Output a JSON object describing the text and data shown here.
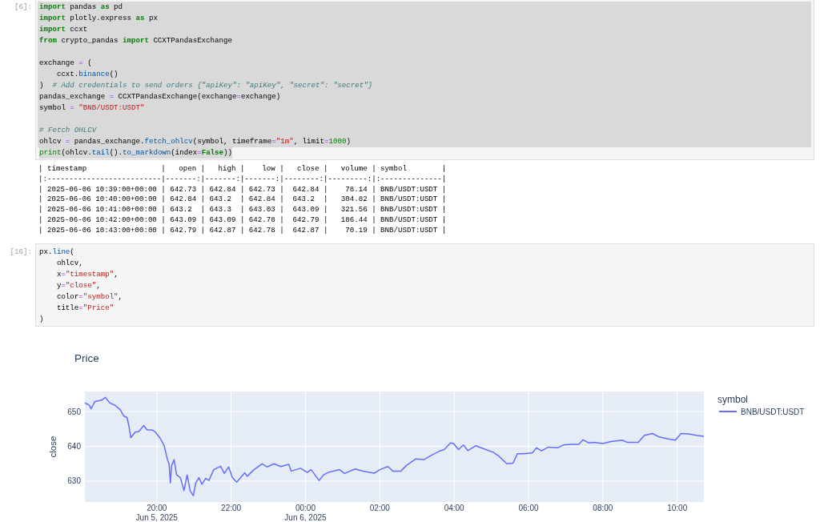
{
  "cells": [
    {
      "kind": "code",
      "prompt": "[6]:",
      "selected": true,
      "lines": [
        {
          "kind": "code",
          "tokens": [
            {
              "kind": "keyword",
              "text": "import"
            },
            {
              "kind": "plain",
              "text": " pandas "
            },
            {
              "kind": "keyword",
              "text": "as"
            },
            {
              "kind": "plain",
              "text": " pd"
            }
          ]
        },
        {
          "kind": "code",
          "tokens": [
            {
              "kind": "keyword",
              "text": "import"
            },
            {
              "kind": "plain",
              "text": " plotly.express "
            },
            {
              "kind": "keyword",
              "text": "as"
            },
            {
              "kind": "plain",
              "text": " px"
            }
          ]
        },
        {
          "kind": "code",
          "tokens": [
            {
              "kind": "keyword",
              "text": "import"
            },
            {
              "kind": "plain",
              "text": " ccxt"
            }
          ]
        },
        {
          "kind": "code",
          "tokens": [
            {
              "kind": "keyword",
              "text": "from"
            },
            {
              "kind": "plain",
              "text": " crypto_pandas "
            },
            {
              "kind": "keyword",
              "text": "import"
            },
            {
              "kind": "plain",
              "text": " CCXTPandasExchange"
            }
          ]
        },
        {
          "kind": "blank"
        },
        {
          "kind": "code",
          "tokens": [
            {
              "kind": "plain",
              "text": "exchange "
            },
            {
              "kind": "operator",
              "text": "="
            },
            {
              "kind": "plain",
              "text": " ("
            }
          ]
        },
        {
          "kind": "code",
          "tokens": [
            {
              "kind": "plain",
              "text": "    ccxt."
            },
            {
              "kind": "property",
              "text": "binance"
            },
            {
              "kind": "plain",
              "text": "()"
            }
          ]
        },
        {
          "kind": "code",
          "tokens": [
            {
              "kind": "plain",
              "text": ")  "
            },
            {
              "kind": "comment",
              "text": "# Add credentials to send orders {\"apiKey\": \"apiKey\", \"secret\": \"secret\"}"
            }
          ]
        },
        {
          "kind": "code",
          "tokens": [
            {
              "kind": "plain",
              "text": "pandas_exchange "
            },
            {
              "kind": "operator",
              "text": "="
            },
            {
              "kind": "plain",
              "text": " CCXTPandasExchange(exchange"
            },
            {
              "kind": "operator",
              "text": "="
            },
            {
              "kind": "plain",
              "text": "exchange)"
            }
          ]
        },
        {
          "kind": "code",
          "tokens": [
            {
              "kind": "plain",
              "text": "symbol "
            },
            {
              "kind": "operator",
              "text": "="
            },
            {
              "kind": "string",
              "text": " \"BNB/USDT:USDT\""
            }
          ]
        },
        {
          "kind": "blank"
        },
        {
          "kind": "code",
          "tokens": [
            {
              "kind": "comment",
              "text": "# Fetch OHLCV"
            }
          ]
        },
        {
          "kind": "code",
          "tokens": [
            {
              "kind": "plain",
              "text": "ohlcv "
            },
            {
              "kind": "operator",
              "text": "="
            },
            {
              "kind": "plain",
              "text": " pandas_exchange."
            },
            {
              "kind": "property",
              "text": "fetch_ohlcv"
            },
            {
              "kind": "plain",
              "text": "(symbol, timeframe"
            },
            {
              "kind": "operator",
              "text": "="
            },
            {
              "kind": "string",
              "text": "\"1m\""
            },
            {
              "kind": "plain",
              "text": ", limit"
            },
            {
              "kind": "operator",
              "text": "="
            },
            {
              "kind": "number",
              "text": "1000"
            },
            {
              "kind": "plain",
              "text": ")"
            }
          ]
        },
        {
          "kind": "code",
          "tokens": [
            {
              "kind": "builtin",
              "text": "print"
            },
            {
              "kind": "plain",
              "text": "(ohlcv."
            },
            {
              "kind": "property",
              "text": "tail"
            },
            {
              "kind": "plain",
              "text": "()."
            },
            {
              "kind": "property",
              "text": "to_markdown"
            },
            {
              "kind": "plain",
              "text": "(index"
            },
            {
              "kind": "operator",
              "text": "="
            },
            {
              "kind": "keyword",
              "text": "False"
            },
            {
              "kind": "plain",
              "text": "))"
            }
          ]
        }
      ]
    },
    {
      "kind": "output",
      "lines": [
        "| timestamp                 |   open |   high |    low |   close |   volume | symbol        |",
        "|:--------------------------|-------:|-------:|-------:|--------:|---------:|:--------------|",
        "| 2025-06-06 10:39:00+00:00 | 642.73 | 642.84 | 642.73 |  642.84 |    78.14 | BNB/USDT:USDT |",
        "| 2025-06-06 10:40:00+00:00 | 642.84 | 643.2  | 642.84 |  643.2  |   304.82 | BNB/USDT:USDT |",
        "| 2025-06-06 10:41:00+00:00 | 643.2  | 643.3  | 643.03 |  643.09 |   321.56 | BNB/USDT:USDT |",
        "| 2025-06-06 10:42:00+00:00 | 643.09 | 643.09 | 642.78 |  642.79 |   186.44 | BNB/USDT:USDT |",
        "| 2025-06-06 10:43:00+00:00 | 642.79 | 642.87 | 642.78 |  642.87 |    70.19 | BNB/USDT:USDT |"
      ]
    },
    {
      "kind": "code",
      "prompt": "[16]:",
      "selected": false,
      "lines": [
        {
          "kind": "code",
          "tokens": [
            {
              "kind": "plain",
              "text": "px."
            },
            {
              "kind": "property",
              "text": "line"
            },
            {
              "kind": "plain",
              "text": "("
            }
          ]
        },
        {
          "kind": "code",
          "tokens": [
            {
              "kind": "plain",
              "text": "    ohlcv,"
            }
          ]
        },
        {
          "kind": "code",
          "tokens": [
            {
              "kind": "plain",
              "text": "    x"
            },
            {
              "kind": "operator",
              "text": "="
            },
            {
              "kind": "string",
              "text": "\"timestamp\""
            },
            {
              "kind": "plain",
              "text": ","
            }
          ]
        },
        {
          "kind": "code",
          "tokens": [
            {
              "kind": "plain",
              "text": "    y"
            },
            {
              "kind": "operator",
              "text": "="
            },
            {
              "kind": "string",
              "text": "\"close\""
            },
            {
              "kind": "plain",
              "text": ","
            }
          ]
        },
        {
          "kind": "code",
          "tokens": [
            {
              "kind": "plain",
              "text": "    color"
            },
            {
              "kind": "operator",
              "text": "="
            },
            {
              "kind": "string",
              "text": "\"symbol\""
            },
            {
              "kind": "plain",
              "text": ","
            }
          ]
        },
        {
          "kind": "code",
          "tokens": [
            {
              "kind": "plain",
              "text": "    title"
            },
            {
              "kind": "operator",
              "text": "="
            },
            {
              "kind": "string",
              "text": "\"Price\""
            }
          ]
        },
        {
          "kind": "code",
          "tokens": [
            {
              "kind": "plain",
              "text": ")"
            }
          ]
        }
      ]
    },
    {
      "kind": "figure",
      "legend_title": "symbol",
      "chart_data": {
        "type": "line",
        "title": "Price",
        "ylabel": "close",
        "grid": true,
        "x": [
          "2025-06-05 18:04",
          "2025-06-05 18:11",
          "2025-06-05 18:14",
          "2025-06-05 18:20",
          "2025-06-05 18:31",
          "2025-06-05 18:37",
          "2025-06-05 18:44",
          "2025-06-05 18:52",
          "2025-06-05 19:01",
          "2025-06-05 19:07",
          "2025-06-05 19:12",
          "2025-06-05 19:15",
          "2025-06-05 19:18",
          "2025-06-05 19:25",
          "2025-06-05 19:31",
          "2025-06-05 19:39",
          "2025-06-05 19:44",
          "2025-06-05 19:53",
          "2025-06-05 19:58",
          "2025-06-05 20:06",
          "2025-06-05 20:12",
          "2025-06-05 20:17",
          "2025-06-05 20:20",
          "2025-06-05 20:22",
          "2025-06-05 20:24",
          "2025-06-05 20:28",
          "2025-06-05 20:32",
          "2025-06-05 20:38",
          "2025-06-05 20:44",
          "2025-06-05 20:49",
          "2025-06-05 20:54",
          "2025-06-05 20:59",
          "2025-06-05 21:03",
          "2025-06-05 21:08",
          "2025-06-05 21:13",
          "2025-06-05 21:19",
          "2025-06-05 21:24",
          "2025-06-05 21:32",
          "2025-06-05 21:43",
          "2025-06-05 21:49",
          "2025-06-05 21:56",
          "2025-06-05 22:02",
          "2025-06-05 22:09",
          "2025-06-05 22:22",
          "2025-06-05 22:26",
          "2025-06-05 22:37",
          "2025-06-05 22:50",
          "2025-06-05 22:58",
          "2025-06-05 23:09",
          "2025-06-05 23:20",
          "2025-06-05 23:33",
          "2025-06-05 23:37",
          "2025-06-05 23:52",
          "2025-06-06 00:03",
          "2025-06-06 00:09",
          "2025-06-06 00:22",
          "2025-06-06 00:29",
          "2025-06-06 00:37",
          "2025-06-06 00:55",
          "2025-06-06 01:03",
          "2025-06-06 01:20",
          "2025-06-06 01:33",
          "2025-06-06 01:51",
          "2025-06-06 02:00",
          "2025-06-06 02:13",
          "2025-06-06 02:21",
          "2025-06-06 02:34",
          "2025-06-06 02:43",
          "2025-06-06 02:58",
          "2025-06-06 03:11",
          "2025-06-06 03:24",
          "2025-06-06 03:37",
          "2025-06-06 03:44",
          "2025-06-06 03:54",
          "2025-06-06 03:59",
          "2025-06-06 04:07",
          "2025-06-06 04:15",
          "2025-06-06 04:22",
          "2025-06-06 04:35",
          "2025-06-06 04:51",
          "2025-06-06 05:03",
          "2025-06-06 05:12",
          "2025-06-06 05:19",
          "2025-06-06 05:25",
          "2025-06-06 05:35",
          "2025-06-06 05:42",
          "2025-06-06 05:51",
          "2025-06-06 06:06",
          "2025-06-06 06:13",
          "2025-06-06 06:21",
          "2025-06-06 06:32",
          "2025-06-06 06:47",
          "2025-06-06 06:56",
          "2025-06-06 07:09",
          "2025-06-06 07:21",
          "2025-06-06 07:28",
          "2025-06-06 07:37",
          "2025-06-06 07:45",
          "2025-06-06 08:00",
          "2025-06-06 08:13",
          "2025-06-06 08:31",
          "2025-06-06 08:39",
          "2025-06-06 08:57",
          "2025-06-06 09:07",
          "2025-06-06 09:20",
          "2025-06-06 09:31",
          "2025-06-06 09:44",
          "2025-06-06 09:57",
          "2025-06-06 10:06",
          "2025-06-06 10:18",
          "2025-06-06 10:31",
          "2025-06-06 10:43"
        ],
        "series": [
          {
            "name": "BNB/USDT:USDT",
            "color": "#636efa",
            "values": [
              652.5,
              651.9,
              650.8,
              652.9,
              653.3,
              654.1,
              652.5,
              651.9,
              650.6,
              648.7,
              648.3,
              646,
              642.5,
              644.1,
              644.3,
              646,
              644.8,
              644.7,
              644.1,
              642.2,
              640.2,
              636.4,
              634.8,
              629.5,
              634.5,
              636.2,
              631.8,
              631,
              627.3,
              631.8,
              627.2,
              625.8,
              629.5,
              631,
              629.1,
              630.8,
              630.2,
              633.3,
              634.3,
              632.2,
              634.1,
              631,
              629.7,
              632.4,
              631.4,
              633.3,
              635,
              634.1,
              635,
              634.2,
              634.8,
              632.9,
              633.7,
              632.5,
              633.3,
              630.2,
              631.8,
              632.5,
              633.3,
              632.2,
              633.5,
              632.9,
              632.3,
              633.3,
              634.2,
              632.9,
              632.9,
              634.5,
              636.4,
              636.2,
              637.5,
              638.7,
              639.1,
              641,
              640.8,
              639.1,
              640.4,
              638.8,
              640.2,
              639.1,
              638.3,
              637.2,
              636,
              635,
              635.2,
              637.9,
              637.9,
              638.1,
              639.6,
              638.7,
              639.8,
              639.6,
              640.4,
              640.6,
              640.6,
              641.9,
              641,
              641.2,
              640.8,
              641.4,
              641.8,
              641.2,
              641.2,
              643.2,
              643.7,
              642.7,
              642.2,
              641.8,
              643.7,
              643.6,
              643.2,
              642.9
            ]
          }
        ],
        "xlim": [
          "2025-06-05 18:04",
          "2025-06-06 10:43"
        ],
        "ylim": [
          624,
          655.8
        ],
        "xticks": [
          {
            "value": "2025-06-05 20:00",
            "label": "20:00\nJun 5, 2025"
          },
          {
            "value": "2025-06-05 22:00",
            "label": "22:00"
          },
          {
            "value": "2025-06-06 00:00",
            "label": "00:00\nJun 6, 2025"
          },
          {
            "value": "2025-06-06 02:00",
            "label": "02:00"
          },
          {
            "value": "2025-06-06 04:00",
            "label": "04:00"
          },
          {
            "value": "2025-06-06 06:00",
            "label": "06:00"
          },
          {
            "value": "2025-06-06 08:00",
            "label": "08:00"
          },
          {
            "value": "2025-06-06 10:00",
            "label": "10:00"
          }
        ],
        "yticks": [
          630,
          640,
          650
        ]
      }
    }
  ]
}
